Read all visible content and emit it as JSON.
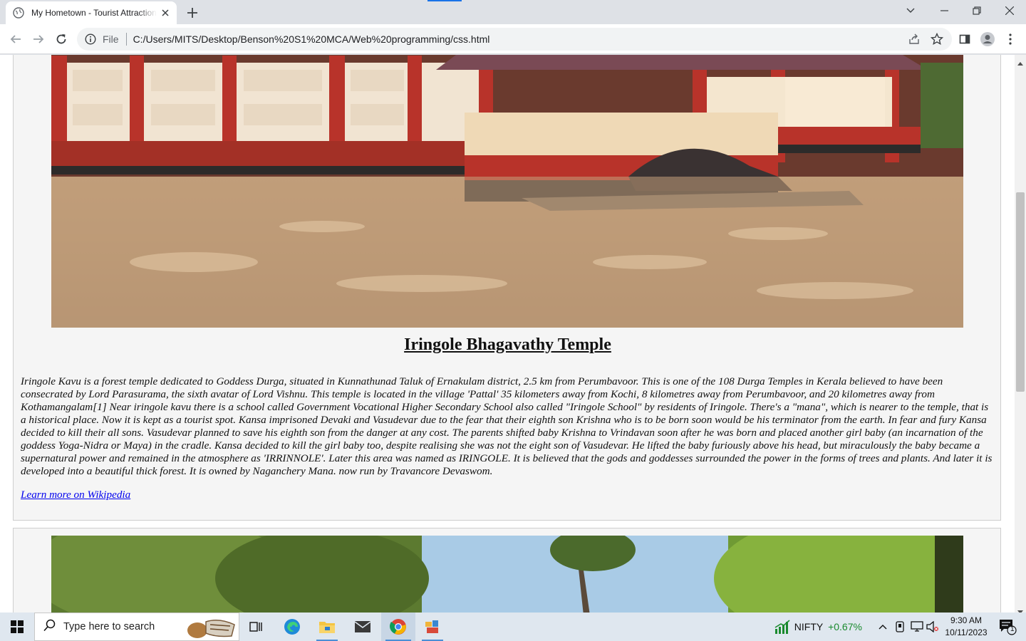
{
  "browser": {
    "tab_title": "My Hometown - Tourist Attractions",
    "scheme_label": "File",
    "url": "C:/Users/MITS/Desktop/Benson%20S1%20MCA/Web%20programming/css.html"
  },
  "page": {
    "section_title": "Iringole Bhagavathy Temple",
    "description": "Iringole Kavu is a forest temple dedicated to Goddess Durga, situated in Kunnathunad Taluk of Ernakulam district, 2.5 km from Perumbavoor. This is one of the 108 Durga Temples in Kerala believed to have been consecrated by Lord Parasurama, the sixth avatar of Lord Vishnu. This temple is located in the village 'Pattal' 35 kilometers away from Kochi, 8 kilometres away from Perumbavoor, and 20 kilometres away from Kothamangalam[1] Near iringole kavu there is a school called Government Vocational Higher Secondary School also called \"Iringole School\" by residents of Iringole. There's a \"mana\", which is nearer to the temple, that is a historical place. Now it is kept as a tourist spot. Kansa imprisoned Devaki and Vasudevar due to the fear that their eighth son Krishna who is to be born soon would be his terminator from the earth. In fear and fury Kansa decided to kill their all sons. Vasudevar planned to save his eighth son from the danger at any cost. The parents shifted baby Krishna to Vrindavan soon after he was born and placed another girl baby (an incarnation of the goddess Yoga-Nidra or Maya) in the cradle. Kansa decided to kill the girl baby too, despite realising she was not the eight son of Vasudevar. He lifted the baby furiously above his head, but miraculously the baby became a supernatural power and remained in the atmosphere as 'IRRINNOLE'. Later this area was named as IRINGOLE. It is believed that the gods and goddesses surrounded the power in the forms of trees and plants. And later it is developed into a beautiful thick forest. It is owned by Naganchery Mana. now run by Travancore Devaswom.",
    "wiki_link": "Learn more on Wikipedia"
  },
  "taskbar": {
    "search_placeholder": "Type here to search",
    "ticker_name": "NIFTY",
    "ticker_change": "+0.67%",
    "time": "9:30 AM",
    "date": "10/11/2023",
    "notification_count": "1"
  },
  "colors": {
    "accent": "#1a73e8",
    "link": "#0000ee",
    "ticker_up": "#1a8a2e"
  }
}
